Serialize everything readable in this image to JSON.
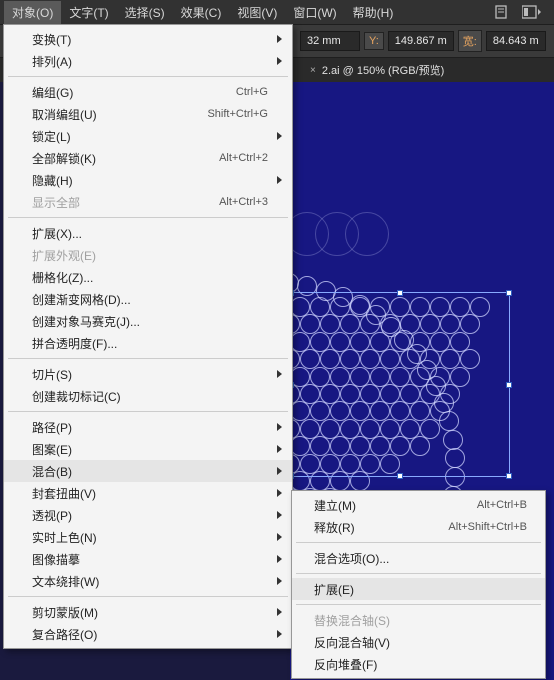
{
  "menubar": {
    "items": [
      {
        "label": "对象(O)",
        "active": true
      },
      {
        "label": "文字(T)"
      },
      {
        "label": "选择(S)"
      },
      {
        "label": "效果(C)"
      },
      {
        "label": "视图(V)"
      },
      {
        "label": "窗口(W)"
      },
      {
        "label": "帮助(H)"
      }
    ]
  },
  "options_bar": {
    "x_suffix": "32 mm",
    "y_label": "Y:",
    "y_value": "149.867 m",
    "w_label": "宽:",
    "w_value": "84.643 m"
  },
  "tab": {
    "icon": "×",
    "title": "2.ai @ 150% (RGB/预览)"
  },
  "main_menu": [
    {
      "label": "变换(T)",
      "submenu": true
    },
    {
      "label": "排列(A)",
      "submenu": true
    },
    {
      "sep": true
    },
    {
      "label": "编组(G)",
      "shortcut": "Ctrl+G"
    },
    {
      "label": "取消编组(U)",
      "shortcut": "Shift+Ctrl+G"
    },
    {
      "label": "锁定(L)",
      "submenu": true
    },
    {
      "label": "全部解锁(K)",
      "shortcut": "Alt+Ctrl+2"
    },
    {
      "label": "隐藏(H)",
      "submenu": true
    },
    {
      "label": "显示全部",
      "shortcut": "Alt+Ctrl+3",
      "disabled": true
    },
    {
      "sep": true
    },
    {
      "label": "扩展(X)..."
    },
    {
      "label": "扩展外观(E)",
      "disabled": true
    },
    {
      "label": "栅格化(Z)..."
    },
    {
      "label": "创建渐变网格(D)..."
    },
    {
      "label": "创建对象马赛克(J)..."
    },
    {
      "label": "拼合透明度(F)..."
    },
    {
      "sep": true
    },
    {
      "label": "切片(S)",
      "submenu": true
    },
    {
      "label": "创建裁切标记(C)"
    },
    {
      "sep": true
    },
    {
      "label": "路径(P)",
      "submenu": true
    },
    {
      "label": "图案(E)",
      "submenu": true
    },
    {
      "label": "混合(B)",
      "submenu": true,
      "highlight": true
    },
    {
      "label": "封套扭曲(V)",
      "submenu": true
    },
    {
      "label": "透视(P)",
      "submenu": true
    },
    {
      "label": "实时上色(N)",
      "submenu": true
    },
    {
      "label": "图像描摹",
      "submenu": true
    },
    {
      "label": "文本绕排(W)",
      "submenu": true
    },
    {
      "sep": true
    },
    {
      "label": "剪切蒙版(M)",
      "submenu": true
    },
    {
      "label": "复合路径(O)",
      "submenu": true
    }
  ],
  "submenu": [
    {
      "label": "建立(M)",
      "shortcut": "Alt+Ctrl+B"
    },
    {
      "label": "释放(R)",
      "shortcut": "Alt+Shift+Ctrl+B"
    },
    {
      "sep": true
    },
    {
      "label": "混合选项(O)..."
    },
    {
      "sep": true
    },
    {
      "label": "扩展(E)",
      "highlight": true
    },
    {
      "sep": true
    },
    {
      "label": "替换混合轴(S)",
      "disabled": true
    },
    {
      "label": "反向混合轴(V)"
    },
    {
      "label": "反向堆叠(F)"
    }
  ]
}
